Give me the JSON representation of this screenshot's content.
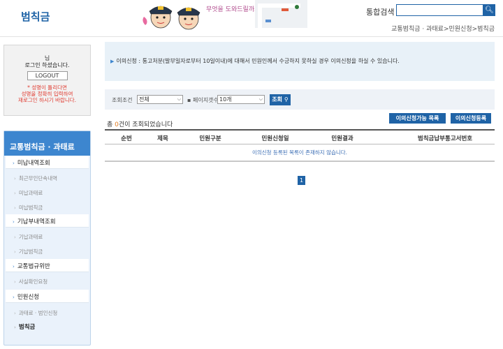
{
  "header": {
    "title": "범칙금",
    "search_label": "통합검색",
    "search_value": "",
    "breadcrumb": "교통범칙금 · 과태료>민원신청>범칙금",
    "mascot_text": "무엇을 도와드릴까요?"
  },
  "login": {
    "user_suffix": "님",
    "message": "로그인 하셨습니다.",
    "logout_label": "LOGOUT",
    "warning_line1": "* 성명이 틀리다면",
    "warning_line2": "성명을 정확히 입력하여",
    "warning_line3": "재로그인 하시기 바랍니다."
  },
  "sidebar": {
    "title": "교통범칙금 · 과태료",
    "items": [
      {
        "label": "미납내역조회",
        "type": "main"
      },
      {
        "label": "최근무인단속내역",
        "type": "sub"
      },
      {
        "label": "미납과태료",
        "type": "sub"
      },
      {
        "label": "미납범칙금",
        "type": "sub"
      },
      {
        "label": "기납부내역조회",
        "type": "main"
      },
      {
        "label": "기납과태료",
        "type": "sub"
      },
      {
        "label": "기납범칙금",
        "type": "sub"
      },
      {
        "label": "교통법규위반",
        "type": "main"
      },
      {
        "label": "사실확인요청",
        "type": "sub"
      },
      {
        "label": "민원신청",
        "type": "main"
      },
      {
        "label": "과태료 · 범인신청",
        "type": "sub"
      },
      {
        "label": "범칙금",
        "type": "sub-active"
      }
    ]
  },
  "notice": {
    "text": "이의신청 : 통고처분(발부일자로부터 10일이내)에 대해서 민원인께서 수긍하지 못하실 경우 이의신청을 하실 수 있습니다."
  },
  "query": {
    "condition_label": "조회조건",
    "condition_value": "전체",
    "page_size_label": "페이지갯수",
    "page_size_value": "10개",
    "search_button": "조회"
  },
  "actions": {
    "available_list": "이의신청가능 목록",
    "register": "이의신청등록"
  },
  "result": {
    "prefix": "총 ",
    "count": "0",
    "suffix": "건이 조회되었습니다"
  },
  "table": {
    "columns": [
      "순번",
      "제목",
      "민원구분",
      "민원신청일",
      "민원결과",
      "범칙금납부통고서번호"
    ],
    "empty_message": "이의신청 등록된 목록이 존재하지 않습니다."
  },
  "pagination": {
    "current": "1"
  },
  "colors": {
    "primary": "#1f63a6",
    "sidebar_header": "#3d86cf",
    "warning": "#e03c31",
    "count": "#e07a1f"
  }
}
